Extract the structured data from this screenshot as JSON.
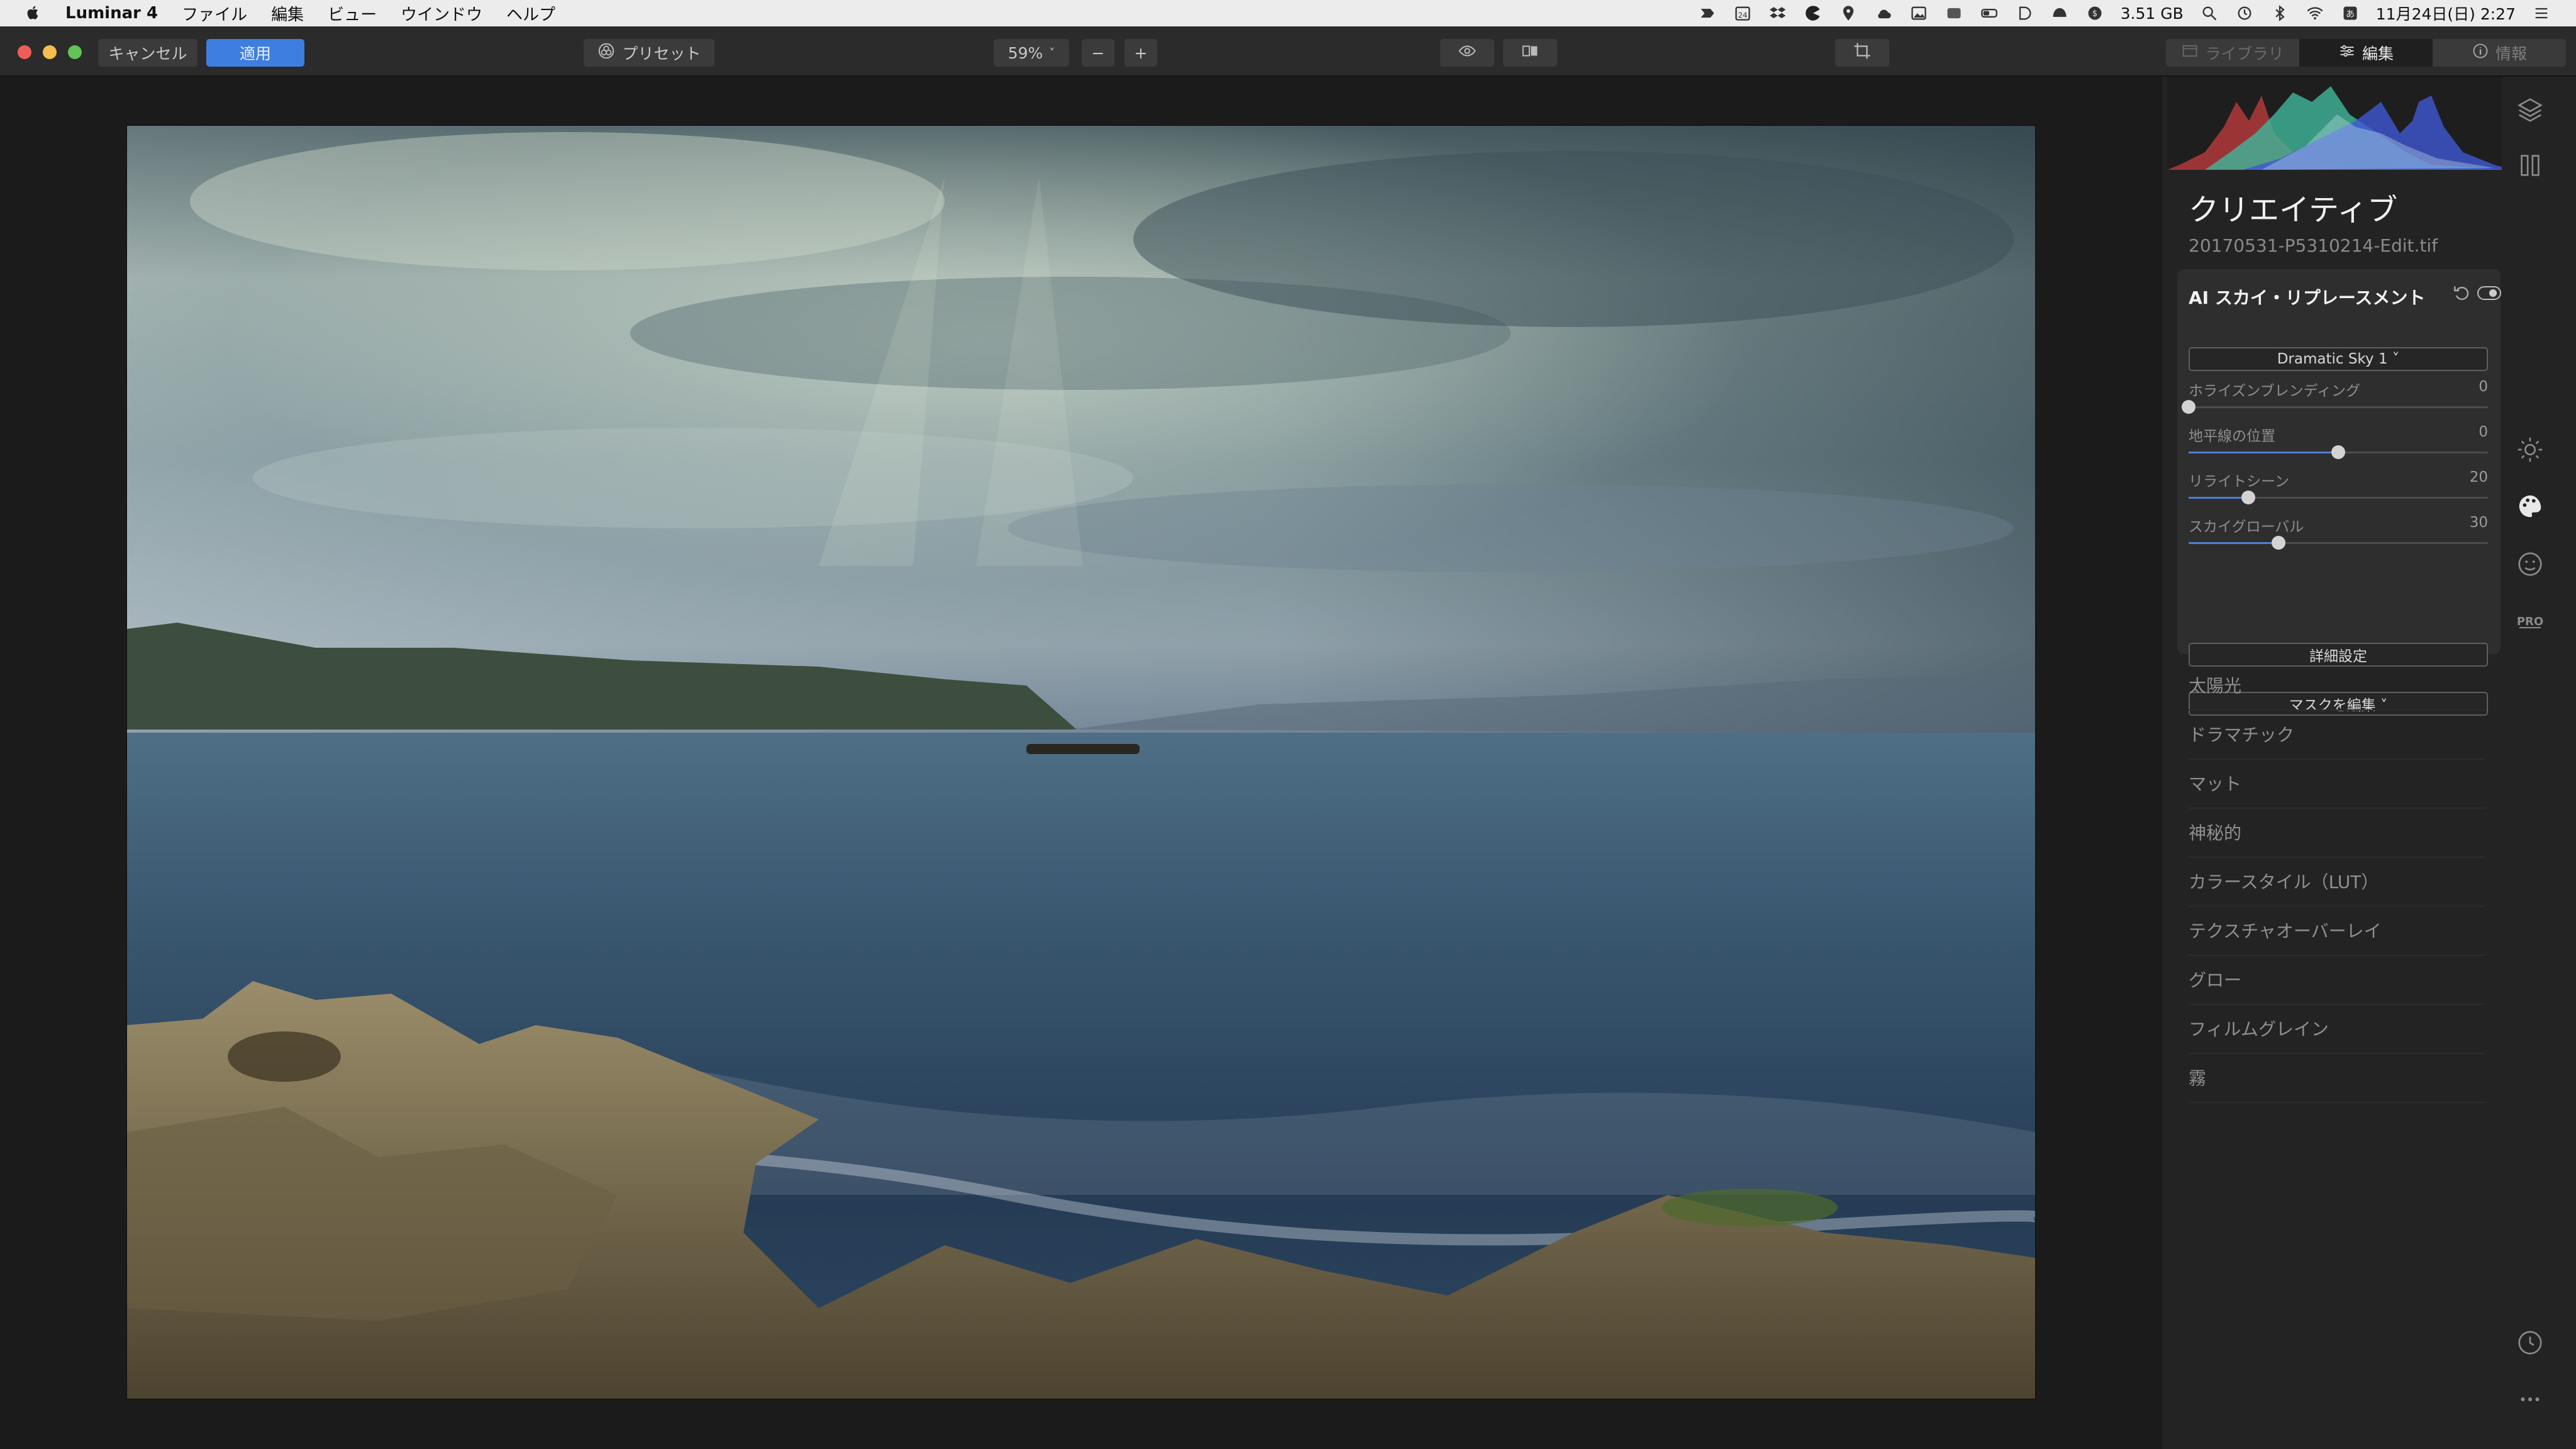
{
  "menubar": {
    "app_name": "Luminar 4",
    "menus": [
      "ファイル",
      "編集",
      "ビュー",
      "ウインドウ",
      "ヘルプ"
    ],
    "status": {
      "storage": "3.51 GB",
      "calendar_day": "24",
      "datetime": "11月24日(日)  2:27"
    }
  },
  "toolbar": {
    "cancel_label": "キャンセル",
    "apply_label": "適用",
    "preset_label": "プリセット",
    "zoom_value": "59%",
    "zoom_out_label": "−",
    "zoom_in_label": "+",
    "tabs": [
      {
        "label": "ライブラリ",
        "icon": "library-icon"
      },
      {
        "label": "編集",
        "icon": "sliders-icon"
      },
      {
        "label": "情報",
        "icon": "info-icon"
      }
    ],
    "active_tab": "編集",
    "apply_color": "#3d7ee0"
  },
  "panel": {
    "title": "クリエイティブ",
    "file_name": "20170531-P5310214-Edit.tif",
    "tool": {
      "title": "AI スカイ・リプレースメント",
      "sky_select": "Dramatic Sky 1 ˅",
      "sliders": [
        {
          "label": "ホライズンブレンディング",
          "value": "0",
          "level": 0.0
        },
        {
          "label": "地平線の位置",
          "value": "0",
          "level": 0.5
        },
        {
          "label": "リライトシーン",
          "value": "20",
          "level": 0.2
        },
        {
          "label": "スカイグローバル",
          "value": "30",
          "level": 0.3
        }
      ],
      "detail_label": "詳細設定",
      "mask_label": "マスクを編集 ˅"
    },
    "categories": [
      "太陽光",
      "ドラマチック",
      "マット",
      "神秘的",
      "カラースタイル（LUT）",
      "テクスチャオーバーレイ",
      "グロー",
      "フィルムグレイン",
      "霧"
    ]
  },
  "sidebar": {
    "pro_label": "PRO"
  }
}
